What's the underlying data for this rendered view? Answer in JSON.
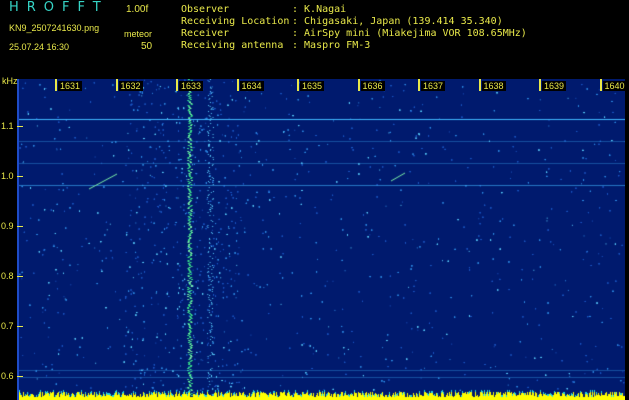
{
  "header": {
    "app_title": "HROFFT",
    "version": "1.00f",
    "filename": "KN9_2507241630.png",
    "datetime": "25.07.24 16:30",
    "meteor_label": "meteor",
    "meteor_count": "50",
    "observer_label": "Observer",
    "observer_value": ": K.Nagai",
    "location_label": "Receiving Location",
    "location_value": ": Chigasaki, Japan (139.414 35.340)",
    "receiver_label": "Receiver",
    "receiver_value": ": AirSpy mini (Miakejima VOR 108.65MHz)",
    "antenna_label": "Receiving antenna",
    "antenna_value": ": Maspro FM-3"
  },
  "axis": {
    "y_unit": "kHz",
    "y_ticks": [
      "1.1",
      "1.0",
      "0.9",
      "0.8",
      "0.7",
      "0.6"
    ],
    "x_ticks": [
      "1631",
      "1632",
      "1633",
      "1634",
      "1635",
      "1636",
      "1637",
      "1638",
      "1639",
      "1640"
    ]
  },
  "colors": {
    "background": "#001a6e",
    "text": "#e8e84a",
    "title": "#36d4c6",
    "signal": "#38e08a",
    "noise": "#3fb6ff",
    "baseline": "#ffff00"
  }
}
